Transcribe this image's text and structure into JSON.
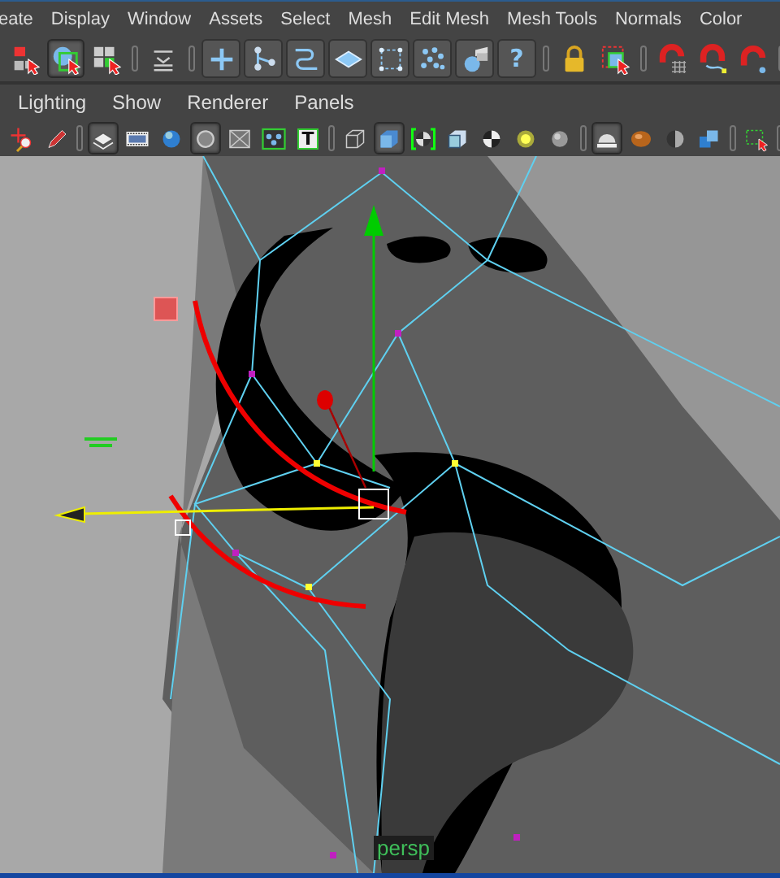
{
  "menubar": [
    "eate",
    "Display",
    "Window",
    "Assets",
    "Select",
    "Mesh",
    "Edit Mesh",
    "Mesh Tools",
    "Normals",
    "Color"
  ],
  "shelf": [
    {
      "kind": "plain",
      "buttons": [
        {
          "kind": "select-hierarchy",
          "selected": false
        },
        {
          "kind": "select-object",
          "selected": true
        },
        {
          "kind": "select-component",
          "selected": false
        }
      ]
    },
    {
      "kind": "plain",
      "buttons": [
        {
          "kind": "stack",
          "selected": false
        }
      ]
    },
    {
      "kind": "boxed",
      "buttons": [
        {
          "kind": "cross",
          "selected": false
        },
        {
          "kind": "vertices",
          "selected": false
        },
        {
          "kind": "curve",
          "selected": false
        },
        {
          "kind": "plane",
          "selected": false
        },
        {
          "kind": "bounding",
          "selected": false
        },
        {
          "kind": "particles",
          "selected": false
        },
        {
          "kind": "render-sphere",
          "selected": false
        },
        {
          "kind": "glyph",
          "glyph": "?",
          "selected": false
        }
      ]
    },
    {
      "kind": "plain",
      "buttons": [
        {
          "kind": "lock",
          "selected": false
        },
        {
          "kind": "select-rect",
          "selected": false
        }
      ]
    },
    {
      "kind": "plain",
      "buttons": [
        {
          "kind": "magnet-grid",
          "selected": false
        },
        {
          "kind": "magnet-curve",
          "selected": false
        },
        {
          "kind": "magnet-point",
          "selected": false
        }
      ]
    }
  ],
  "panel_menu": [
    "Lighting",
    "Show",
    "Renderer",
    "Panels"
  ],
  "panel_toolbar": [
    {
      "kind": "plain",
      "buttons": [
        {
          "kind": "move-zoom",
          "selected": false
        },
        {
          "kind": "pencil",
          "selected": false
        }
      ]
    },
    {
      "kind": "plain",
      "buttons": [
        {
          "kind": "layers",
          "selected": true
        },
        {
          "kind": "film",
          "selected": false
        },
        {
          "kind": "blue-sphere",
          "selected": false
        },
        {
          "kind": "circle",
          "selected": true
        },
        {
          "kind": "xray",
          "selected": false
        },
        {
          "kind": "nodes",
          "selected": false
        },
        {
          "kind": "glyph",
          "glyph": "T",
          "selected": false
        }
      ]
    },
    {
      "kind": "plain",
      "buttons": [
        {
          "kind": "wire-cube",
          "selected": false
        },
        {
          "kind": "solid-cube",
          "selected": true
        },
        {
          "kind": "checker-bracket",
          "selected": false
        },
        {
          "kind": "cube",
          "selected": false
        },
        {
          "kind": "checker-ball",
          "selected": false
        },
        {
          "kind": "light",
          "selected": false
        },
        {
          "kind": "gray-ball",
          "selected": false
        }
      ]
    },
    {
      "kind": "plain",
      "buttons": [
        {
          "kind": "dome",
          "selected": true
        },
        {
          "kind": "orange-ball",
          "selected": false
        },
        {
          "kind": "half-sphere",
          "selected": false
        },
        {
          "kind": "cubes",
          "selected": false
        }
      ]
    },
    {
      "kind": "plain",
      "buttons": [
        {
          "kind": "dashed-select",
          "selected": false
        }
      ]
    }
  ],
  "viewport": {
    "camera": "persp"
  }
}
